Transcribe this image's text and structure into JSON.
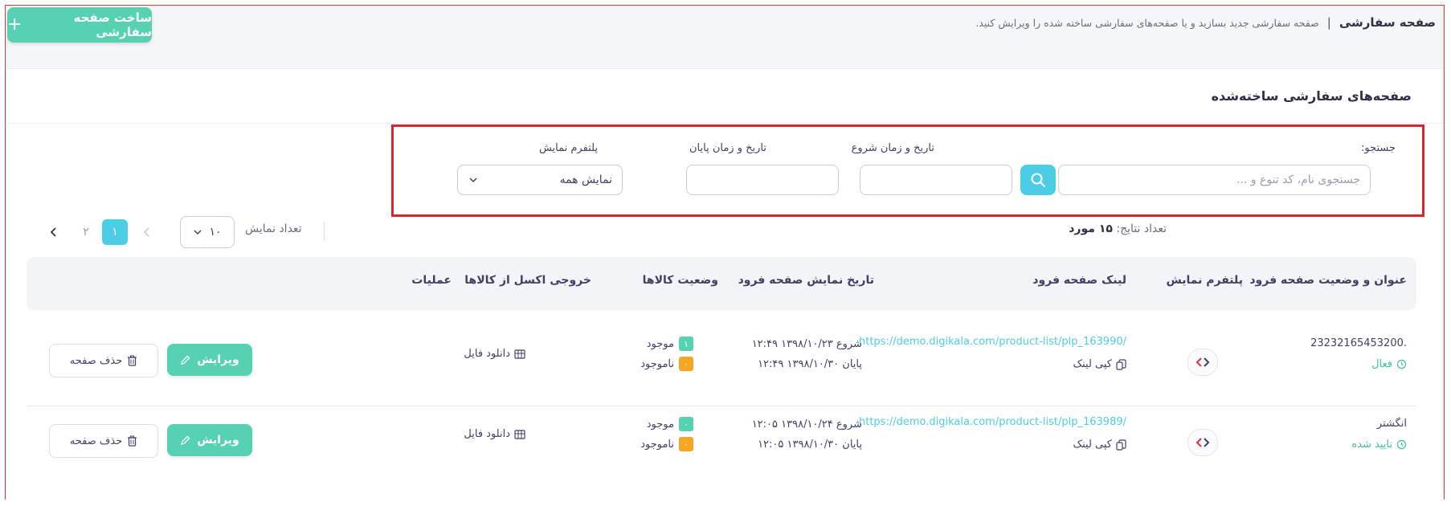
{
  "header": {
    "title": "صفحه سفارشی",
    "description": "صفحه سفارشی جدید بسازید و یا صفحه‌های سفارشی ساخته شده را ویرایش کنید.",
    "create_button": "ساخت صفحه سفارشی"
  },
  "card": {
    "title": "صفحه‌های سفارشی ساخته‌شده"
  },
  "filters": {
    "search_label": "جستجو:",
    "search_placeholder": "جستجوی نام، کد تنوع و ...",
    "start_label": "تاریخ و زمان شروع",
    "end_label": "تاریخ و زمان پایان",
    "platform_label": "پلتفرم نمایش",
    "platform_value": "نمایش همه"
  },
  "pagination": {
    "results_label": "تعداد نتایج:",
    "results_value": "۱۵ مورد",
    "show_label": "تعداد نمایش",
    "per_page": "۱۰",
    "pages": [
      "۱",
      "۲"
    ]
  },
  "table": {
    "headers": {
      "title": "عنوان و وضعیت صفحه فرود",
      "platform": "پلتفرم نمایش",
      "link": "لینک صفحه فرود",
      "dates": "تاریخ نمایش صفحه فرود",
      "stock": "وضعیت کالاها",
      "excel": "خروجی اکسل از کالاها",
      "actions": "عملیات"
    },
    "rows": [
      {
        "title": ".23232165453200",
        "status": "فعال",
        "link": "https://demo.digikala.com/product-list/plp_163990/",
        "copy": "کپی لینک",
        "start": "شروع ۱۳۹۸/۱۰/۲۳ ۱۲:۴۹",
        "end": "پایان ۱۳۹۸/۱۰/۳۰ ۱۲:۴۹",
        "available_count": "۱",
        "available_label": "موجود",
        "unavailable_count": "۰",
        "unavailable_label": "ناموجود",
        "download": "دانلود فایل",
        "edit": "ویرایش",
        "delete": "حذف صفحه"
      },
      {
        "title": "انگشتر",
        "status": "تایید شده",
        "link": "https://demo.digikala.com/product-list/plp_163989/",
        "copy": "کپی لینک",
        "start": "شروع ۱۳۹۸/۱۰/۲۴ ۱۲:۰۵",
        "end": "پایان ۱۳۹۸/۱۰/۳۰ ۱۲:۰۵",
        "available_count": "۰",
        "available_label": "موجود",
        "unavailable_count": "۰",
        "unavailable_label": "ناموجود",
        "download": "دانلود فایل",
        "edit": "ویرایش",
        "delete": "حذف صفحه"
      }
    ]
  },
  "colors": {
    "accent_green": "#56d1b2",
    "accent_cyan": "#4ccde6",
    "orange": "#f6a623",
    "highlight_red": "#d7262d"
  }
}
